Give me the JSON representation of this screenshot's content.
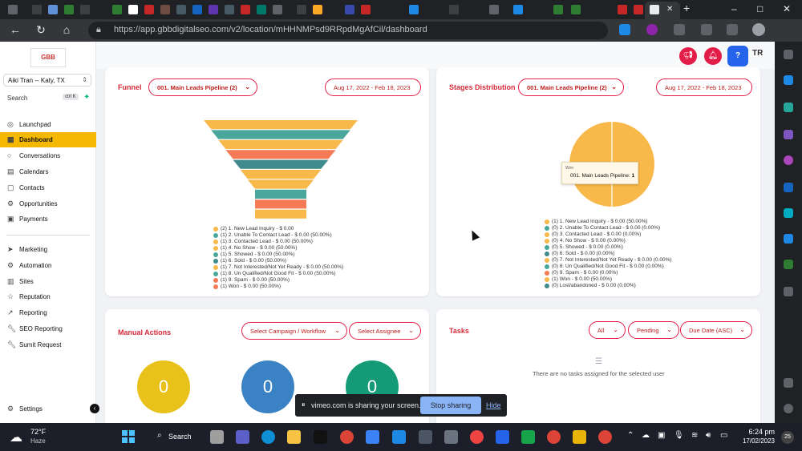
{
  "browser": {
    "url": "https://app.gbbdigitalseo.com/v2/location/mHHNMPsd9RRpdMgAfCil/dashboard",
    "window_controls": {
      "minimize": "–",
      "maximize": "□",
      "close": "✕"
    },
    "new_tab": "+",
    "tab_close": "✕"
  },
  "sidebar": {
    "logo_text": "GBB",
    "location": "Aiki Tran -- Katy, TX",
    "search_placeholder": "Search",
    "search_shortcut": "ctrl K",
    "items": [
      {
        "label": "Launchpad",
        "icon": "launchpad-icon"
      },
      {
        "label": "Dashboard",
        "icon": "dashboard-icon"
      },
      {
        "label": "Conversations",
        "icon": "chat-icon"
      },
      {
        "label": "Calendars",
        "icon": "calendar-icon"
      },
      {
        "label": "Contacts",
        "icon": "contacts-icon"
      },
      {
        "label": "Opportunities",
        "icon": "opportunities-icon"
      },
      {
        "label": "Payments",
        "icon": "payments-icon"
      },
      {
        "label": "Marketing",
        "icon": "marketing-icon"
      },
      {
        "label": "Automation",
        "icon": "automation-icon"
      },
      {
        "label": "Sites",
        "icon": "sites-icon"
      },
      {
        "label": "Reputation",
        "icon": "reputation-icon"
      },
      {
        "label": "Reporting",
        "icon": "reporting-icon"
      },
      {
        "label": "SEO Reporting",
        "icon": "wrench-icon"
      },
      {
        "label": "Sumit Request",
        "icon": "wrench-icon"
      }
    ],
    "settings_label": "Settings",
    "active": "Dashboard"
  },
  "topbar": {
    "help": "?",
    "avatar_initials": "TR"
  },
  "funnel": {
    "title": "Funnel",
    "pipeline": "001. Main Leads Pipeline (2)",
    "date_range": "Aug 17, 2022 - Feb 18, 2023",
    "colors": [
      "#f9b84a",
      "#4aa79b",
      "#f9b84a",
      "#f47b55",
      "#3f8a8c",
      "#f9b84a",
      "#f9b84a",
      "#4aa79b",
      "#f47b55",
      "#f9b84a"
    ],
    "legend": [
      "(2) 1. New Lead Inquiry - $ 0.00",
      "(1) 2. Unable To Contact Lead - $ 0.00 (50.00%)",
      "(1) 3. Contacted Lead - $ 0.00 (50.00%)",
      "(1) 4. No Show - $ 0.00 (50.00%)",
      "(1) 5. Showed - $ 0.00 (50.00%)",
      "(1) 6. Sold - $ 0.00 (50.00%)",
      "(1) 7. Not Interested/Not Yet Ready - $ 0.00 (50.00%)",
      "(1) 8. Un Qualified/Not Good Fit - $ 0.00 (50.00%)",
      "(1) 9. Spam - $ 0.00 (50.00%)",
      "(1) Won - $ 0.00 (50.00%)"
    ],
    "legend_colors": [
      "#f9b84a",
      "#4aa79b",
      "#f9b84a",
      "#f9b84a",
      "#4aa79b",
      "#3f8a8c",
      "#f9b84a",
      "#4aa79b",
      "#f47b55",
      "#f47b55"
    ]
  },
  "stages": {
    "title": "Stages Distribution",
    "pipeline": "001. Main Leads Pipeline (2)",
    "date_range": "Aug 17, 2022 - Feb 18, 2023",
    "tooltip_header": "Won",
    "tooltip_text": "001. Main Leads Pipeline:",
    "tooltip_value": "1",
    "legend": [
      "(1) 1. New Lead Inquiry - $ 0.00 (50.00%)",
      "(0) 2. Unable To Contact Lead - $ 0.00 (0.00%)",
      "(0) 3. Contacted Lead - $ 0.00 (0.00%)",
      "(0) 4. No Show - $ 0.00 (0.00%)",
      "(0) 5. Showed - $ 0.00 (0.00%)",
      "(0) 6. Sold - $ 0.00 (0.00%)",
      "(0) 7. Not Interested/Not Yet Ready - $ 0.00 (0.00%)",
      "(0) 8. Un Qualified/Not Good Fit - $ 0.00 (0.00%)",
      "(0) 9. Spam - $ 0.00 (0.00%)",
      "(1) Won - $ 0.00 (50.00%)",
      "(0) Lost/abandoned - $ 0.00 (0.00%)"
    ],
    "legend_colors": [
      "#f9b84a",
      "#4aa79b",
      "#f9b84a",
      "#f9b84a",
      "#4aa79b",
      "#3f8a8c",
      "#f9b84a",
      "#4aa79b",
      "#f47b55",
      "#f9b84a",
      "#3f8a8c"
    ]
  },
  "manual_actions": {
    "title": "Manual Actions",
    "campaign_select": "Select Campaign / Workflow",
    "assignee_select": "Select Assignee",
    "counts": [
      {
        "value": "0",
        "color": "#e8c11a"
      },
      {
        "value": "0",
        "color": "#3b82c4"
      },
      {
        "value": "0",
        "color": "#159a77"
      }
    ]
  },
  "tasks": {
    "title": "Tasks",
    "filter_all": "All",
    "filter_status": "Pending",
    "filter_sort": "Due Date (ASC)",
    "empty_text": "There are no tasks assigned for the selected user"
  },
  "share_bar": {
    "pause_icon": "⏸",
    "message": "vimeo.com is sharing your screen.",
    "stop_label": "Stop sharing",
    "hide_label": "Hide"
  },
  "taskbar": {
    "temperature": "72°F",
    "condition": "Haze",
    "search_label": "Search",
    "time": "6:24 pm",
    "date": "17/02/2023",
    "notif_count": "25"
  }
}
